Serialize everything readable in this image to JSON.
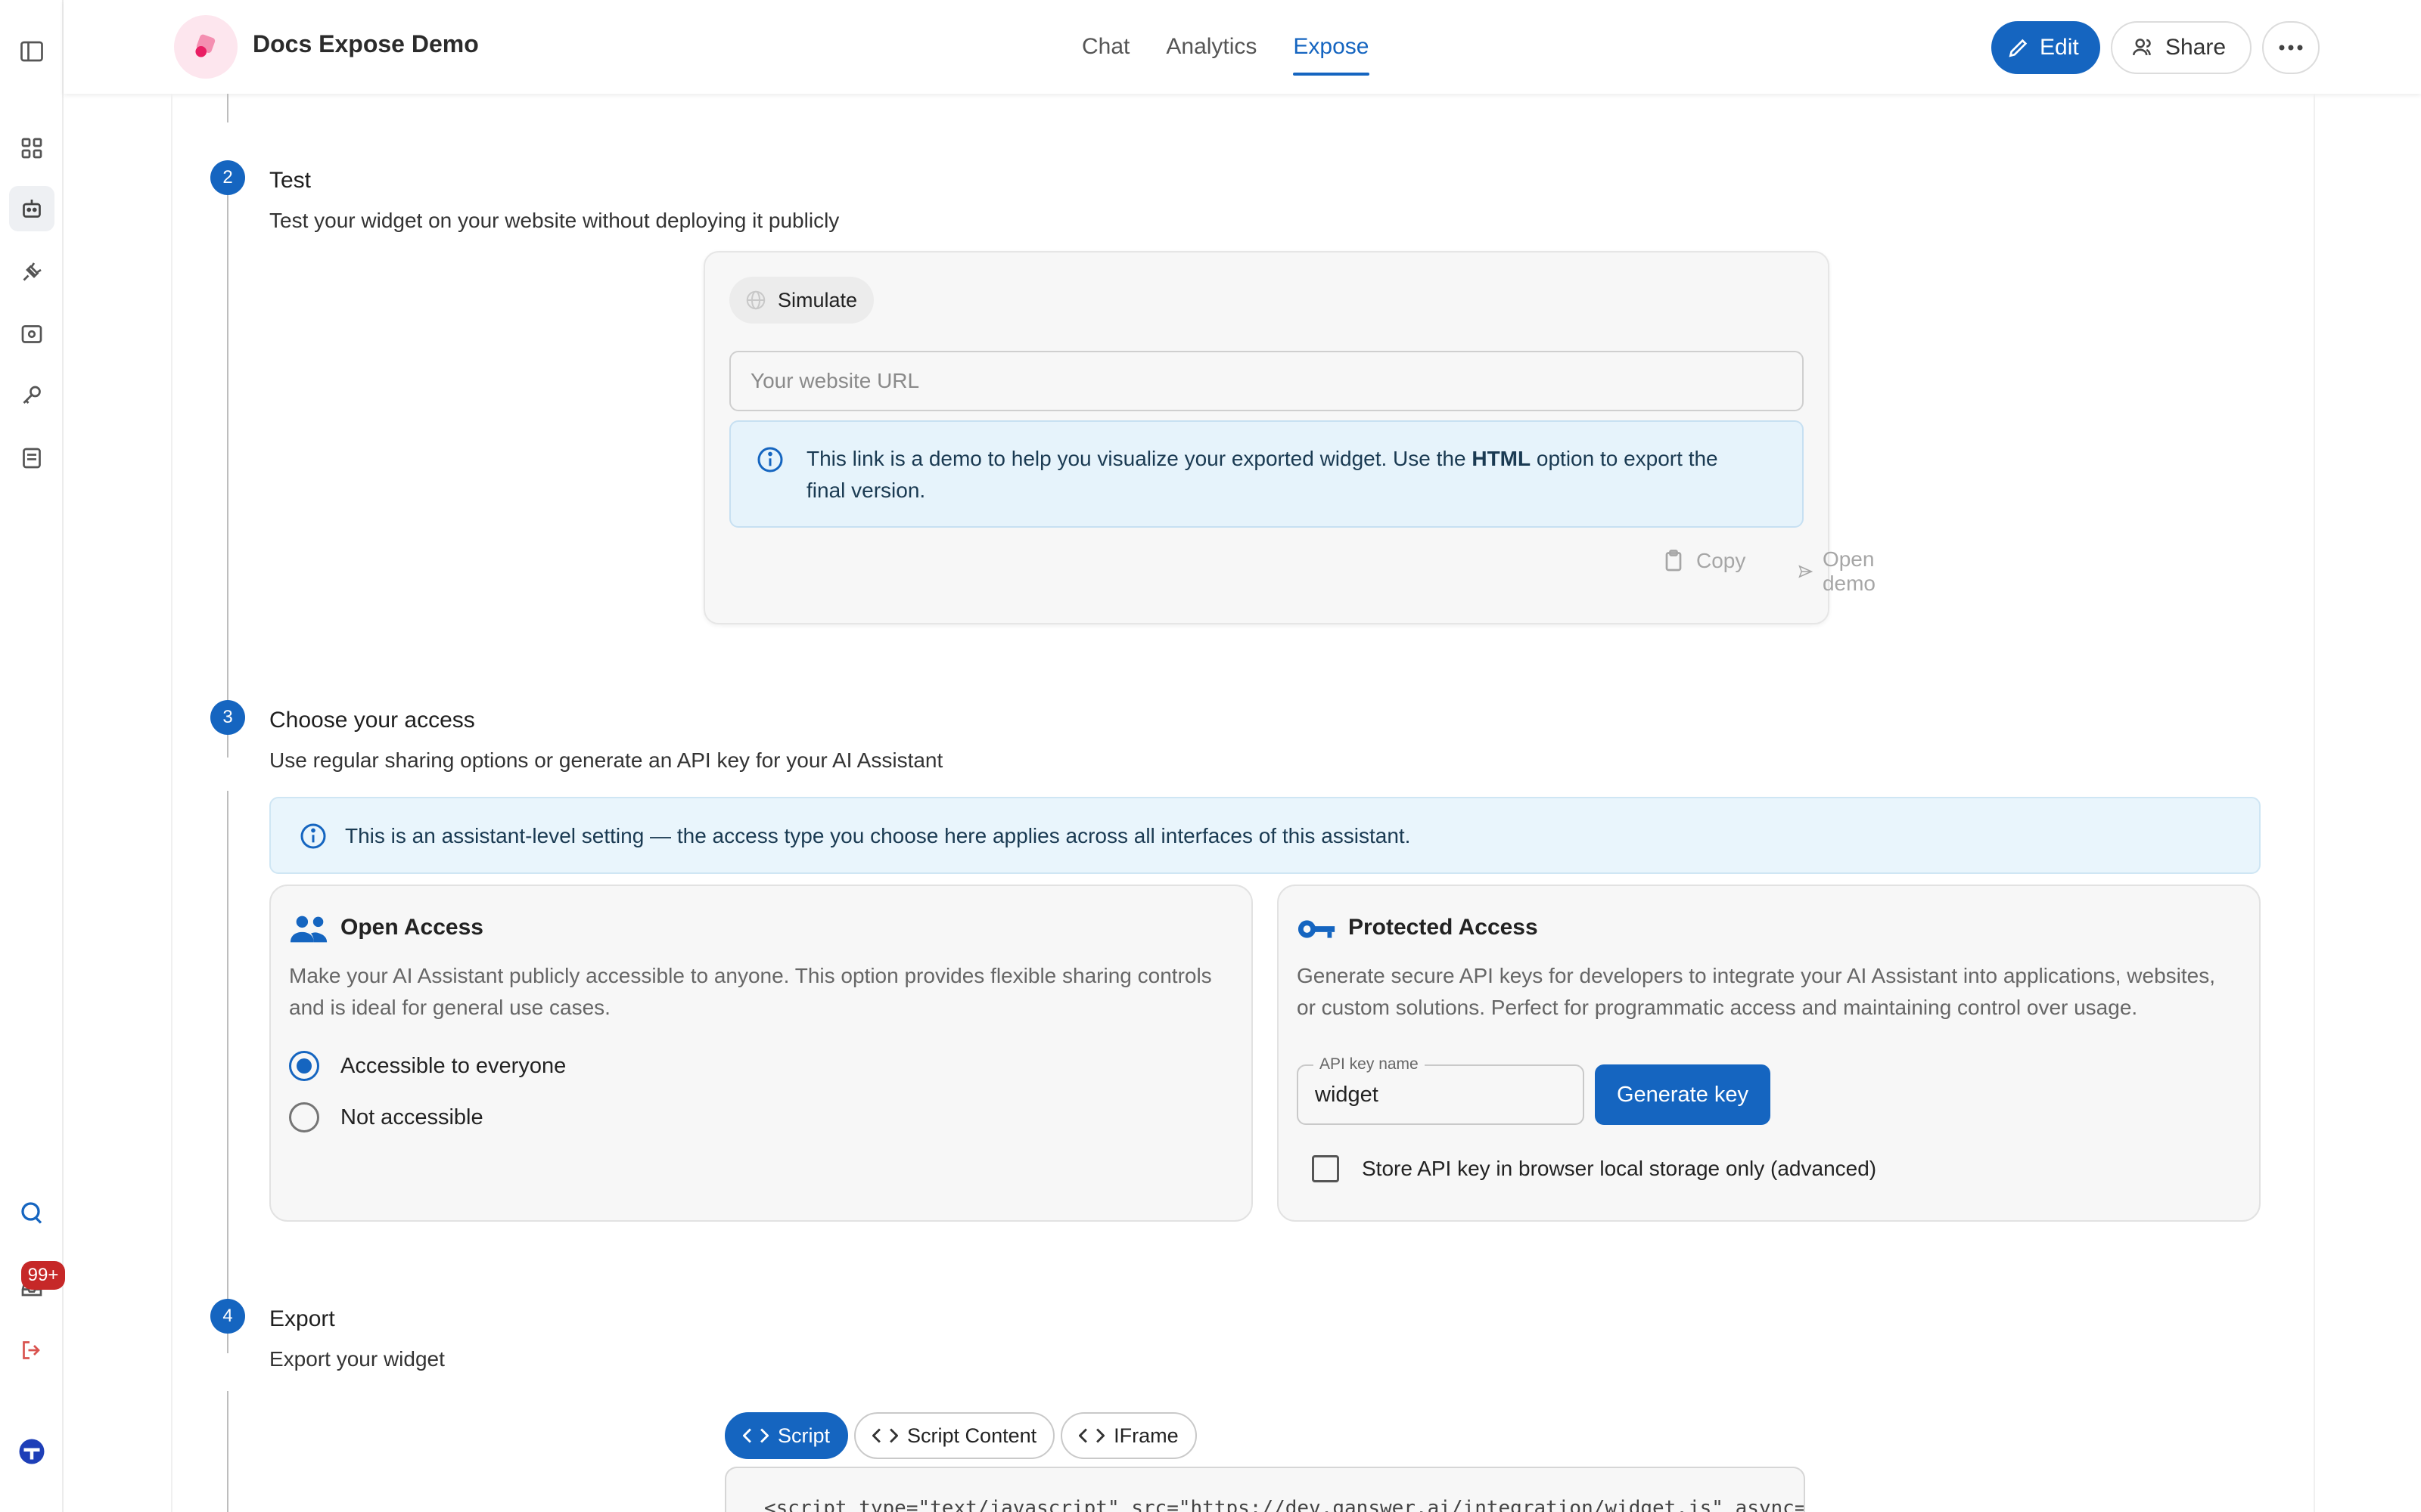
{
  "app": {
    "title": "Docs Expose Demo",
    "tabs": [
      {
        "label": "Chat",
        "active": false
      },
      {
        "label": "Analytics",
        "active": false
      },
      {
        "label": "Expose",
        "active": true
      }
    ],
    "edit_label": "Edit",
    "share_label": "Share"
  },
  "rail": {
    "badge": "99+",
    "icons": [
      "sidebar-toggle-icon",
      "grid-icon",
      "robot-icon",
      "plug-icon",
      "scan-icon",
      "key-icon",
      "book-icon",
      "search-user-icon",
      "inbox-icon",
      "logout-icon",
      "avatar"
    ]
  },
  "steps": {
    "test": {
      "number": "2",
      "title": "Test",
      "desc": "Test your widget on your website without deploying it publicly",
      "chip_label": "Simulate",
      "url_placeholder": "Your website URL",
      "info_before": "This link is a demo to help you visualize your exported widget. Use the ",
      "info_bold": "HTML",
      "info_after": " option to export the final version.",
      "copy_label": "Copy",
      "open_label": "Open demo"
    },
    "access": {
      "number": "3",
      "title": "Choose your access",
      "desc": "Use regular sharing options or generate an API key for your AI Assistant",
      "info": "This is an assistant-level setting — the access type you choose here applies across all interfaces of this assistant.",
      "open": {
        "title": "Open Access",
        "desc": "Make your AI Assistant publicly accessible to anyone. This option provides flexible sharing controls and is ideal for general use cases.",
        "option_yes": "Accessible to everyone",
        "option_no": "Not accessible",
        "selected": "Accessible to everyone"
      },
      "protected": {
        "title": "Protected Access",
        "desc": "Generate secure API keys for developers to integrate your AI Assistant into applications, websites, or custom solutions. Perfect for programmatic access and maintaining control over usage.",
        "key_label": "API key name",
        "key_value": "widget",
        "generate_label": "Generate key",
        "store_label": "Store API key in browser local storage only (advanced)"
      }
    },
    "export": {
      "number": "4",
      "title": "Export",
      "desc": "Export your widget",
      "tabs": [
        {
          "label": "Script",
          "active": true
        },
        {
          "label": "Script Content",
          "active": false
        },
        {
          "label": "IFrame",
          "active": false
        }
      ],
      "code": "<script type=\"text/javascript\" src=\"https://dev.ganswer.ai/integration/widget.js\" async=\"true\""
    }
  },
  "colors": {
    "accent": "#1565c0",
    "info_bg": "#e6f3fb",
    "badge": "#c62828",
    "logout": "#d9534f"
  }
}
